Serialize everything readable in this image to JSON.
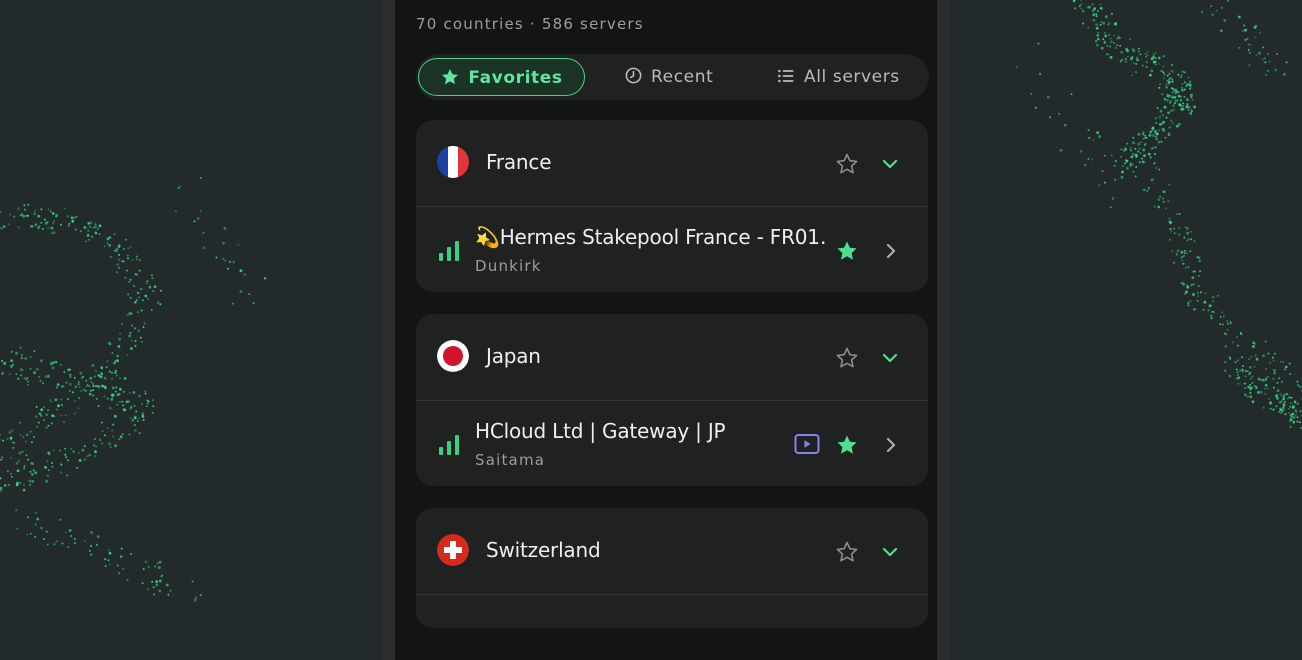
{
  "header": {
    "subtitle": "70 countries · 586 servers"
  },
  "tabs": [
    {
      "label": "Favorites",
      "icon": "star-icon",
      "active": true
    },
    {
      "label": "Recent",
      "icon": "clock-icon",
      "active": false
    },
    {
      "label": "All servers",
      "icon": "list-icon",
      "active": false
    }
  ],
  "groups": [
    {
      "country": "France",
      "flag": "france-flag-icon",
      "favorited": false,
      "server": {
        "name": "💫Hermes Stakepool France - FR01…",
        "city": "Dunkirk",
        "favorited": true,
        "streaming": false
      }
    },
    {
      "country": "Japan",
      "flag": "japan-flag-icon",
      "favorited": false,
      "server": {
        "name": "HCloud Ltd | Gateway | JP",
        "city": "Saitama",
        "favorited": true,
        "streaming": true
      }
    },
    {
      "country": "Switzerland",
      "flag": "switzerland-flag-icon",
      "favorited": false
    }
  ],
  "colors": {
    "accent": "#4ee08f",
    "background": "#222a2b",
    "card": "#202121",
    "streaming": "#8b82f0"
  }
}
